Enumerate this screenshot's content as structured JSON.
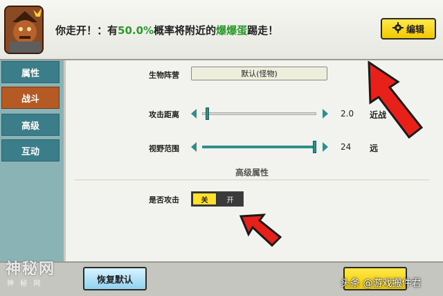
{
  "header": {
    "message_prefix": "你走开！：有",
    "message_percent": "50.0%",
    "message_mid": "概率将附近的",
    "message_item": "爆爆蛋",
    "message_suffix": "踢走！",
    "edit_label": "编辑",
    "edit_icon": "gear-icon"
  },
  "sidebar": {
    "items": [
      {
        "label": "属性"
      },
      {
        "label": "战斗"
      },
      {
        "label": "高级"
      },
      {
        "label": "互动"
      }
    ],
    "active_index": 1
  },
  "settings": {
    "camp_label": "生物阵营",
    "camp_value": "默认(怪物)",
    "attack_range_label": "攻击距离",
    "attack_range_value": "2.0",
    "attack_range_unit": "近战",
    "attack_range_fraction": 0.02,
    "view_range_label": "视野范围",
    "view_range_value": "24",
    "view_range_unit": "远",
    "view_range_fraction": 1.0,
    "advanced_section_title": "高级属性",
    "attack_toggle_label": "是否攻击",
    "toggle_off_label": "关",
    "toggle_on_label": "开",
    "toggle_state": "off"
  },
  "footer": {
    "reset_label": "恢复默认"
  },
  "watermarks": {
    "left_main": "神秘网",
    "left_sub": "神 秘 网",
    "right": "头条 @游戏搬件君"
  },
  "colors": {
    "accent_yellow": "#f2c800",
    "teal": "#2f8d8a",
    "active_tab": "#b55a24",
    "callout_red": "#e8201a"
  }
}
